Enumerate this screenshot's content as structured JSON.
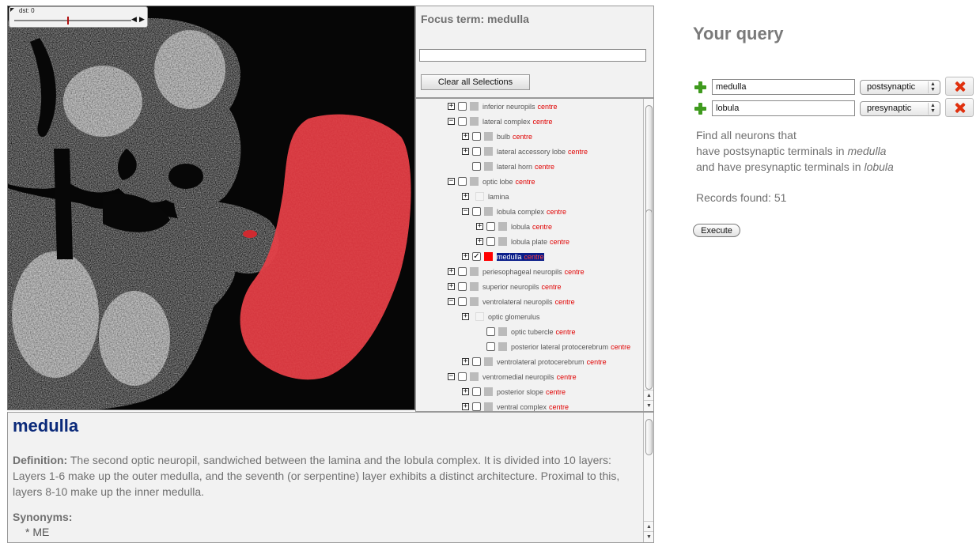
{
  "viewer": {
    "slider_label": "dst: 0",
    "prev_label": "◀",
    "next_label": "▶"
  },
  "focus": {
    "title": "Focus term: medulla",
    "input_value": "",
    "clear_button": "Clear all Selections"
  },
  "tree": {
    "items": [
      {
        "name": "inferior neuropils",
        "centre": "centre",
        "expander": "+",
        "checked": false,
        "swatch": "grey"
      },
      {
        "name": "lateral complex",
        "centre": "centre",
        "expander": "−",
        "checked": false,
        "swatch": "grey"
      },
      {
        "name": "bulb",
        "centre": "centre",
        "expander": "+",
        "checked": false,
        "swatch": "grey"
      },
      {
        "name": "lateral accessory lobe",
        "centre": "centre",
        "expander": "+",
        "checked": false,
        "swatch": "grey"
      },
      {
        "name": "lateral horn",
        "centre": "centre",
        "expander": "",
        "checked": false,
        "swatch": "grey"
      },
      {
        "name": "optic lobe",
        "centre": "centre",
        "expander": "−",
        "checked": false,
        "swatch": "grey"
      },
      {
        "name": "lamina",
        "centre": "",
        "expander": "+",
        "checked": null,
        "swatch": "light"
      },
      {
        "name": "lobula complex",
        "centre": "centre",
        "expander": "−",
        "checked": false,
        "swatch": "grey"
      },
      {
        "name": "lobula",
        "centre": "centre",
        "expander": "+",
        "checked": false,
        "swatch": "grey"
      },
      {
        "name": "lobula plate",
        "centre": "centre",
        "expander": "+",
        "checked": false,
        "swatch": "grey"
      },
      {
        "name": "medulla",
        "centre": "centre",
        "expander": "+",
        "checked": true,
        "swatch": "red",
        "check_glyph": "✓"
      },
      {
        "name": "periesophageal neuropils",
        "centre": "centre",
        "expander": "+",
        "checked": false,
        "swatch": "grey"
      },
      {
        "name": "superior neuropils",
        "centre": "centre",
        "expander": "+",
        "checked": false,
        "swatch": "grey"
      },
      {
        "name": "ventrolateral neuropils",
        "centre": "centre",
        "expander": "−",
        "checked": false,
        "swatch": "grey"
      },
      {
        "name": "optic glomerulus",
        "centre": "",
        "expander": "+",
        "checked": null,
        "swatch": "light"
      },
      {
        "name": "optic tubercle",
        "centre": "centre",
        "expander": "",
        "checked": false,
        "swatch": "grey"
      },
      {
        "name": "posterior lateral protocerebrum",
        "centre": "centre",
        "expander": "",
        "checked": false,
        "swatch": "grey"
      },
      {
        "name": "ventrolateral protocerebrum",
        "centre": "centre",
        "expander": "+",
        "checked": false,
        "swatch": "grey"
      },
      {
        "name": "ventromedial neuropils",
        "centre": "centre",
        "expander": "−",
        "checked": false,
        "swatch": "grey"
      },
      {
        "name": "posterior slope",
        "centre": "centre",
        "expander": "+",
        "checked": false,
        "swatch": "grey"
      },
      {
        "name": "ventral complex",
        "centre": "centre",
        "expander": "+",
        "checked": false,
        "swatch": "grey"
      }
    ],
    "scroll_up": "▲",
    "scroll_down": "▼"
  },
  "definition": {
    "term": "medulla",
    "label": "Definition:",
    "text": "The second optic neuropil, sandwiched between the lamina and the lobula complex. It is divided into 10 layers: Layers 1-6 make up the outer medulla, and the seventh (or serpentine) layer exhibits a distinct architecture. Proximal to this, layers 8-10 make up the inner medulla.",
    "synonyms_label": "Synonyms:",
    "synonym": "* ME"
  },
  "query": {
    "title": "Your query",
    "rows": [
      {
        "term": "medulla",
        "relation": "postsynaptic"
      },
      {
        "term": "lobula",
        "relation": "presynaptic"
      }
    ],
    "find_line": "Find all neurons that",
    "line1_prefix": "have postsynaptic terminals in ",
    "line1_term": "medulla",
    "line2_prefix": "and have presynaptic terminals in ",
    "line2_term": "lobula",
    "records": "Records found: 51",
    "execute": "Execute"
  },
  "colors": {
    "highlight_red": "#e0303a",
    "term_blue": "#0b2a7a",
    "selection_navy": "#0b1f8a",
    "add_green": "#3f9a1e",
    "delete_red": "#e0300e"
  }
}
